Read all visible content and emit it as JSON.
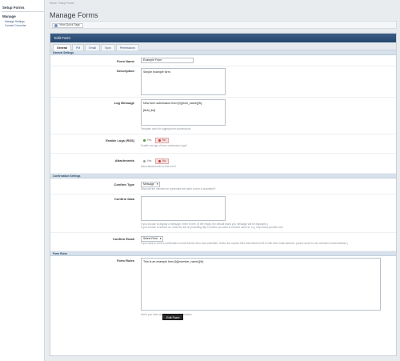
{
  "sidebar": {
    "title": "Setup Forms",
    "group": "Manage",
    "items": [
      "Manage Settings",
      "Contact Converter"
    ]
  },
  "breadcrumb": "Home  /  Setup Forms",
  "page_title": "Manage Forms",
  "quick": {
    "label": "View Quick Tags"
  },
  "panel": {
    "title": "Edit Form"
  },
  "tabs": [
    "General",
    "PM",
    "Email",
    "Sync",
    "Permissions"
  ],
  "sections": {
    "general": "General Settings",
    "confirmation": "Confirmation Settings",
    "rules": "Form Rules"
  },
  "fields": {
    "form_name": {
      "label": "Form Name",
      "value": "Example Form"
    },
    "description": {
      "label": "Description",
      "value": "Simple example form."
    },
    "log_message": {
      "label": "Log Message",
      "value": "New form submission from [b]{form_name}[/b].\n\n[field_list]",
      "help": "Template used for logging form submissions."
    },
    "enable_logs": {
      "label": "Enable Logs (RSS)",
      "yes": "Yes",
      "no": "No",
      "help": "Enable rss logs of form submission logs?"
    },
    "attachments": {
      "label": "Attachments",
      "yes": "Yes",
      "no": "No",
      "help": "Allow attachments to this form?"
    },
    "confirm_type": {
      "label": "Confirm Type",
      "value": "Message",
      "help": "What will the member be presented with after a form is submitted?"
    },
    "confirm_data": {
      "label": "Confirm Data",
      "value": "",
      "help1": "If you choose to display a message, enter it here. (If left empty, the default thank you message will be displayed.)",
      "help2": "If you choose a redirect url, enter the full url (including http://) where you want to redirect users to. e.g. http://www.yoursite.com"
    },
    "confirm_email": {
      "label": "Confirm Email",
      "value": "Select Field",
      "help": "If you want to send a confirmation email that the form was submitted. Select the custom field that members fill in with their email address. (Leave alone to use members email address.)"
    },
    "form_rules": {
      "label": "Form Rules",
      "value": "This is an example form [b]{member_name}[/b].",
      "help": "Add if you have any form rules or instructions."
    }
  },
  "submit": "Edit Form",
  "colors": {
    "header": "#25466d",
    "section": "#d6e1ec",
    "yes": "#4a9a34",
    "no": "#c23a3a"
  }
}
